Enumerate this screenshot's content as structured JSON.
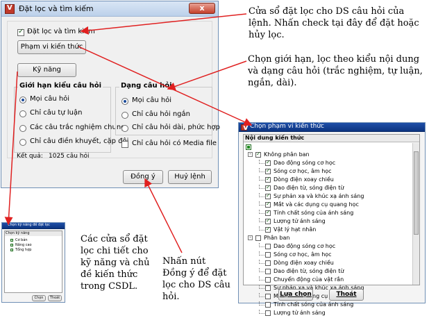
{
  "main_window": {
    "title": "Đặt lọc và tìm kiếm",
    "close_label": "x",
    "filter_checkbox_label": "Đặt lọc và tìm kiếm",
    "filter_checked": true,
    "scope_button": "Phạm vi kiến thức",
    "skills_button": "Kỹ năng",
    "type_group": {
      "title": "Giới hạn kiểu câu hỏi",
      "options": [
        "Mọi câu hỏi",
        "Chỉ câu tự luận",
        "Các câu trắc nghiệm chung",
        "Chỉ câu điền khuyết, cặp đôi"
      ],
      "selected": 0
    },
    "form_group": {
      "title": "Dạng câu hỏi",
      "options": [
        "Mọi câu hỏi",
        "Chỉ câu hỏi ngắn",
        "Chỉ câu hỏi dài, phức hợp"
      ],
      "selected": 0
    },
    "media_checkbox_label": "Chỉ câu hỏi có Media file",
    "result_label": "Kết quả:",
    "result_value": "1025 câu hỏi",
    "ok_button": "Đồng ý",
    "cancel_button": "Huỷ lệnh"
  },
  "scope_window": {
    "title": "Chọn phạm vi kiến thức",
    "header": "Nội dung kiến thức",
    "groups": [
      {
        "label": "Không phân ban",
        "checked": true,
        "items": [
          {
            "label": "Dao động sóng cơ học",
            "checked": true
          },
          {
            "label": "Sóng cơ học, âm học",
            "checked": true
          },
          {
            "label": "Dòng điện xoay chiều",
            "checked": true
          },
          {
            "label": "Dao điện từ, sóng điện từ",
            "checked": true
          },
          {
            "label": "Sự phản xạ và khúc xạ ánh sáng",
            "checked": true
          },
          {
            "label": "Mắt và các dụng cụ quang học",
            "checked": true
          },
          {
            "label": "Tính chất sóng của ánh sáng",
            "checked": true
          },
          {
            "label": "Lượng tử ánh sáng",
            "checked": true
          },
          {
            "label": "Vật lý hạt nhân",
            "checked": true
          }
        ]
      },
      {
        "label": "Phân ban",
        "checked": false,
        "items": [
          {
            "label": "Dao động sóng cơ học",
            "checked": false
          },
          {
            "label": "Sóng cơ học, âm học",
            "checked": false
          },
          {
            "label": "Dòng điện xoay chiều",
            "checked": false
          },
          {
            "label": "Dao điện từ, sóng điện từ",
            "checked": false
          },
          {
            "label": "Chuyển động của vật rắn",
            "checked": false
          },
          {
            "label": "Sự phản xạ và khúc xạ ánh sáng",
            "checked": false
          },
          {
            "label": "Mắt và các dụng cụ quang học",
            "checked": false
          },
          {
            "label": "Tính chất sóng của ánh sáng",
            "checked": false
          },
          {
            "label": "Lượng tử ánh sáng",
            "checked": false
          }
        ]
      }
    ],
    "select_button": "Lựa chọn",
    "exit_button": "Thoát"
  },
  "skills_window": {
    "title": "Chọn kỹ năng đề đặt lọc",
    "header": "Chọn kỹ năng",
    "items": [
      "Cơ bản",
      "Nâng cao",
      "Tổng hợp"
    ],
    "select_button": "Chọn",
    "exit_button": "Thoát"
  },
  "annotations": {
    "filter_window": "Cửa sổ đặt lọc cho DS câu hỏi của lệnh. Nhấn check tại đây để đặt hoặc hủy lọc.",
    "limit": "Chọn giới hạn, lọc theo kiểu nội dung và dạng câu hỏi (trắc nghiệm, tự luận, ngắn, dài).",
    "detail_windows": "Các cửa sổ đặt lọc chi tiết cho kỹ năng và chủ đề kiến thức trong CSDL.",
    "ok_hint": "Nhấn nút Đồng ý để đặt lọc cho DS câu hỏi."
  },
  "colors": {
    "arrow": "#e02020",
    "titlebar": "#c9dbf0",
    "accent": "#1a4a9a"
  }
}
